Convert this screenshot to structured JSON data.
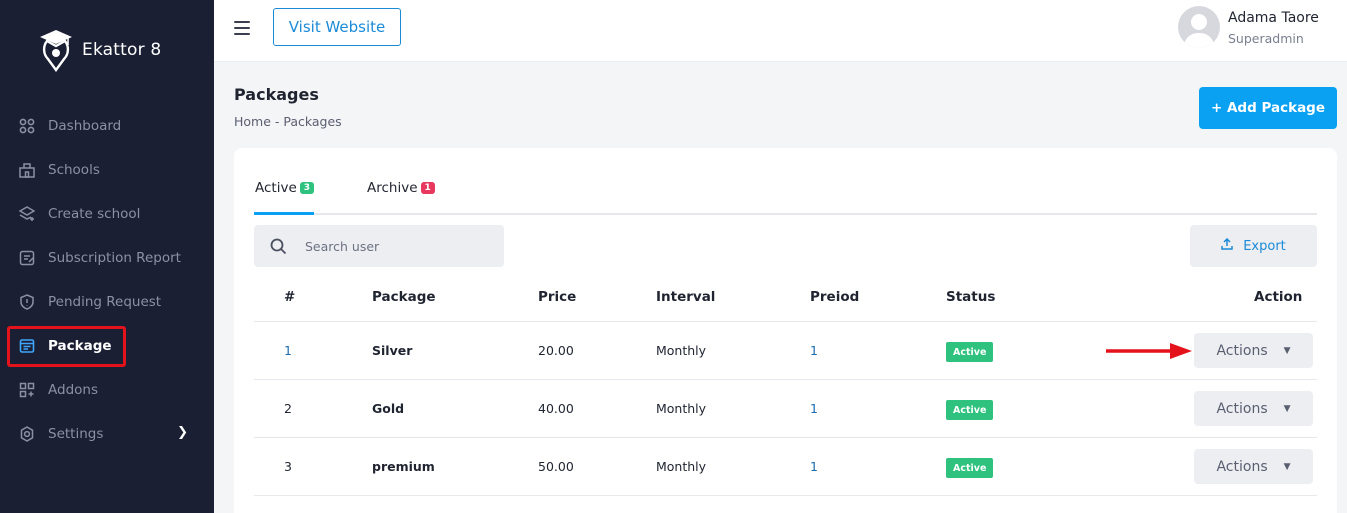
{
  "sidebar": {
    "brand": "Ekattor 8",
    "items": [
      {
        "label": "Dashboard",
        "icon": "grid-icon"
      },
      {
        "label": "Schools",
        "icon": "school-icon"
      },
      {
        "label": "Create school",
        "icon": "layers-icon"
      },
      {
        "label": "Subscription Report",
        "icon": "report-icon"
      },
      {
        "label": "Pending Request",
        "icon": "shield-icon"
      },
      {
        "label": "Package",
        "icon": "package-icon"
      },
      {
        "label": "Addons",
        "icon": "addons-icon"
      },
      {
        "label": "Settings",
        "icon": "gear-icon"
      }
    ]
  },
  "header": {
    "visit_label": "Visit Website",
    "user_name": "Adama Taore",
    "user_role": "Superadmin"
  },
  "page": {
    "title": "Packages",
    "breadcrumb": "Home - Packages",
    "add_label": "+ Add Package"
  },
  "tabs": [
    {
      "label": "Active",
      "count": "3",
      "color": "#2ec27e"
    },
    {
      "label": "Archive",
      "count": "1",
      "color": "#e8385d"
    }
  ],
  "search": {
    "placeholder": "Search user"
  },
  "export_label": "Export",
  "table": {
    "headers": [
      "#",
      "Package",
      "Price",
      "Interval",
      "Preiod",
      "Status",
      "Action"
    ],
    "rows": [
      {
        "num": "1",
        "package": "Silver",
        "price": "20.00",
        "interval": "Monthly",
        "period": "1",
        "status": "Active",
        "action": "Actions"
      },
      {
        "num": "2",
        "package": "Gold",
        "price": "40.00",
        "interval": "Monthly",
        "period": "1",
        "status": "Active",
        "action": "Actions"
      },
      {
        "num": "3",
        "package": "premium",
        "price": "50.00",
        "interval": "Monthly",
        "period": "1",
        "status": "Active",
        "action": "Actions"
      }
    ]
  },
  "colors": {
    "sidebar_bg": "#1b1f33",
    "accent": "#0aa1f2",
    "highlight": "#e3121b",
    "status_active": "#2ec27e"
  }
}
